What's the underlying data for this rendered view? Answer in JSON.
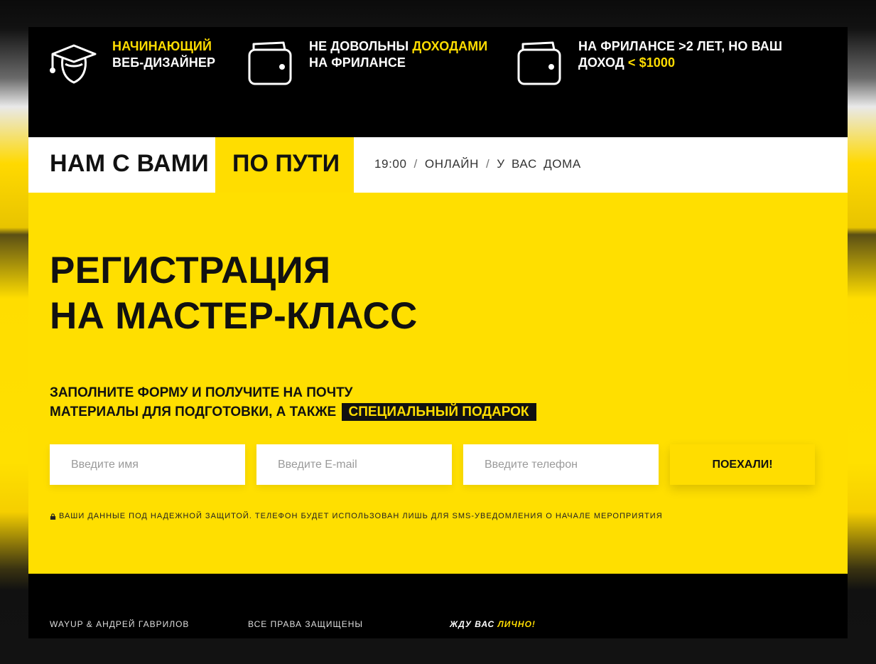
{
  "features": [
    {
      "icon": "graduate-icon",
      "line1_highlight": "Начинающий",
      "line2": "веб-дизайнер"
    },
    {
      "icon": "wallet-icon",
      "line1_prefix": "Не довольны ",
      "line1_highlight": "доходами",
      "line2": "на фрилансе"
    },
    {
      "icon": "wallet-icon",
      "line1": "На фрилансе >2 лет, но ваш",
      "line2_prefix": "доход ",
      "line2_highlight": "< $1000"
    }
  ],
  "bar": {
    "title_left": "НАМ С ВАМИ",
    "title_right": "ПО ПУТИ",
    "time": "19:00",
    "sep": "/",
    "mode": "ОНЛАЙН",
    "place": "У ВАС ДОМА"
  },
  "registration": {
    "title_line1": "Регистрация",
    "title_line2": "на мастер-класс",
    "sub_line1": "Заполните форму и получите на почту",
    "sub_line2": "материалы для подготовки, а также",
    "gift": "специальный подарок"
  },
  "form": {
    "name_placeholder": "Введите имя",
    "email_placeholder": "Введите E-mail",
    "phone_placeholder": "Введите телефон",
    "submit_label": "ПОЕХАЛИ!"
  },
  "privacy_note": "Ваши данные под надежной защитой. Телефон будет использован лишь для sms-уведомления о начале мероприятия",
  "footer": {
    "brand": "WAYUP & Андрей Гаврилов",
    "rights": "Все права защищены",
    "personal_prefix": "Жду вас ",
    "personal_highlight": "лично!"
  },
  "colors": {
    "accent": "#ffdd00",
    "dark": "#000000",
    "light": "#ffffff"
  }
}
